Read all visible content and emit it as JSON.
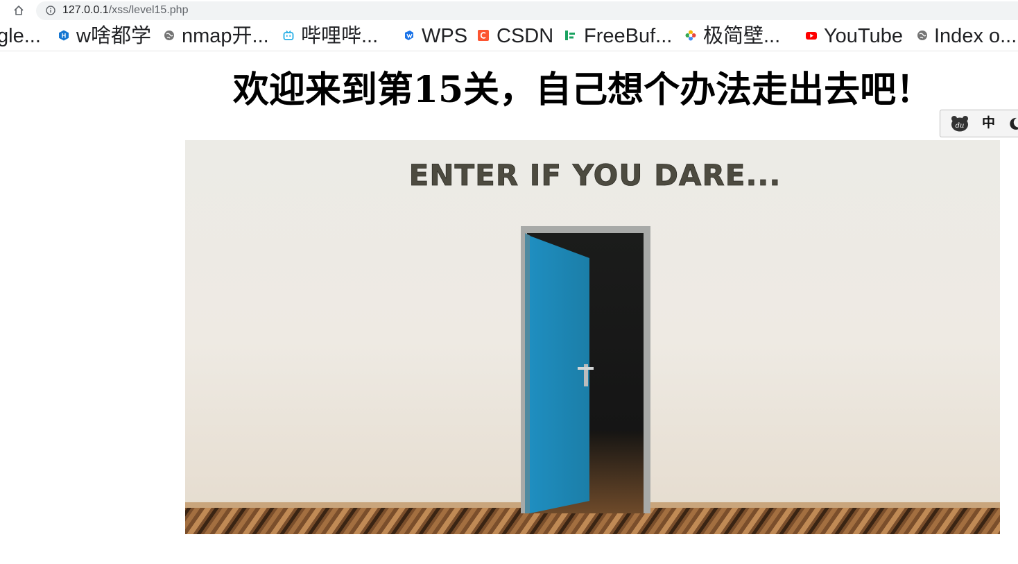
{
  "browser": {
    "url_host": "127.0.0.1",
    "url_path": "/xss/level15.php"
  },
  "bookmarks": [
    {
      "label": "gle...",
      "icon": "none"
    },
    {
      "label": "w啥都学",
      "icon": "hexagon-h-icon"
    },
    {
      "label": "nmap开...",
      "icon": "globe-icon"
    },
    {
      "label": "哔哩哔...",
      "icon": "bilibili-tv-icon"
    },
    {
      "label": "WPS",
      "icon": "wps-icon"
    },
    {
      "label": "CSDN",
      "icon": "csdn-icon"
    },
    {
      "label": "FreeBuf...",
      "icon": "freebuf-icon"
    },
    {
      "label": "极简壁...",
      "icon": "pinwheel-icon"
    },
    {
      "label": "YouTube",
      "icon": "youtube-icon"
    },
    {
      "label": "Index o...",
      "icon": "globe-icon"
    }
  ],
  "page": {
    "heading": "欢迎来到第15关，自己想个办法走出去吧！",
    "image_caption": "ENTER IF YOU DARE..."
  },
  "ime_toolbar": {
    "mode_label": "中"
  },
  "colors": {
    "door": "#1f8fb8",
    "wall": "#ece9e2",
    "floor": "#6b4426"
  }
}
